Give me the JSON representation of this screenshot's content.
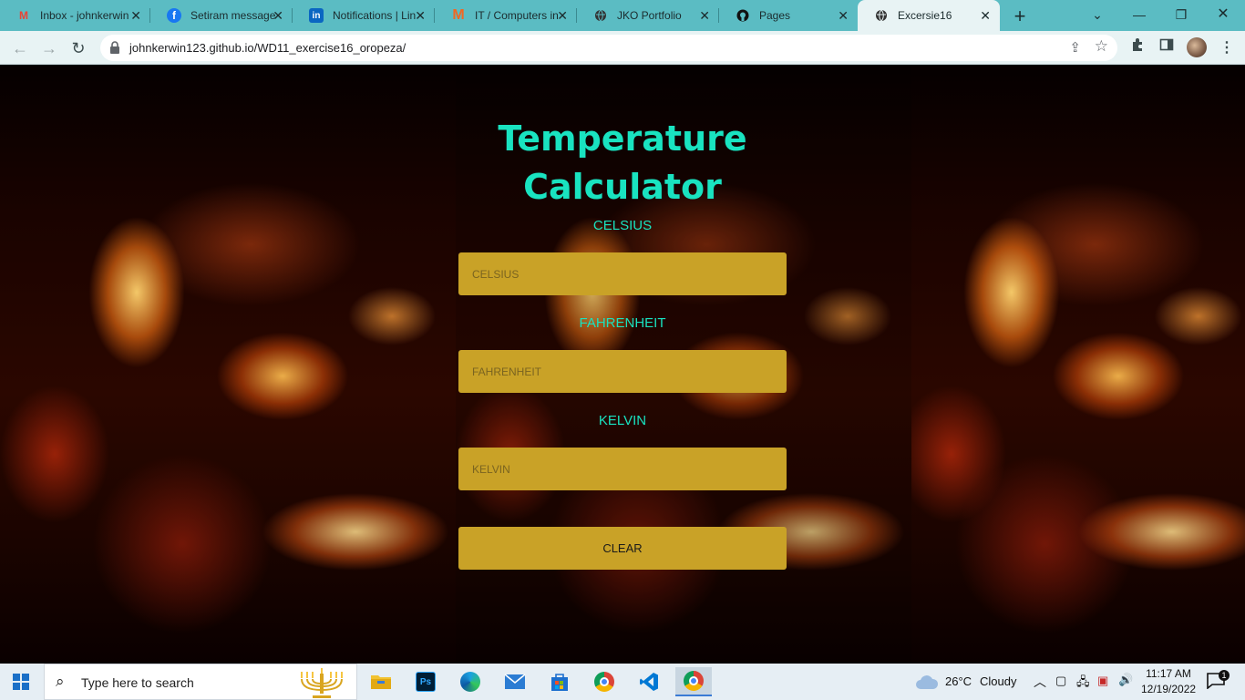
{
  "browser": {
    "tabs": [
      {
        "label": "Inbox - johnkerwin",
        "icon": "gmail-icon",
        "icon_color": "#ea4335"
      },
      {
        "label": "Setiram message",
        "icon": "facebook-icon",
        "icon_color": "#1877f2"
      },
      {
        "label": "Notifications | Lin",
        "icon": "linkedin-icon",
        "icon_color": "#0a66c2"
      },
      {
        "label": "IT / Computers in",
        "icon": "m-icon",
        "icon_color": "#f26722"
      },
      {
        "label": "JKO Portfolio",
        "icon": "globe-icon",
        "icon_color": "#333333"
      },
      {
        "label": "Pages",
        "icon": "github-icon",
        "icon_color": "#111111"
      },
      {
        "label": "Excersie16",
        "icon": "globe-icon",
        "icon_color": "#333333"
      }
    ],
    "active_tab_index": 6,
    "url": "johnkerwin123.github.io/WD11_exercise16_oropeza/"
  },
  "page": {
    "title_line1": "Temperature",
    "title_line2": "Calculator",
    "accent_color": "#19e3c0",
    "field_color": "#c9a227",
    "fields": [
      {
        "label": "CELSIUS",
        "placeholder": "CELSIUS"
      },
      {
        "label": "FAHRENHEIT",
        "placeholder": "FAHRENHEIT"
      },
      {
        "label": "KELVIN",
        "placeholder": "KELVIN"
      }
    ],
    "clear_label": "CLEAR"
  },
  "taskbar": {
    "search_placeholder": "Type here to search",
    "weather_temp": "26°C",
    "weather_text": "Cloudy",
    "time": "11:17 AM",
    "date": "12/19/2022",
    "notification_count": "1",
    "apps": [
      "file-explorer-icon",
      "photoshop-icon",
      "edge-icon",
      "mail-icon",
      "store-icon",
      "chrome-icon",
      "vscode-icon",
      "chrome-active-icon"
    ]
  }
}
